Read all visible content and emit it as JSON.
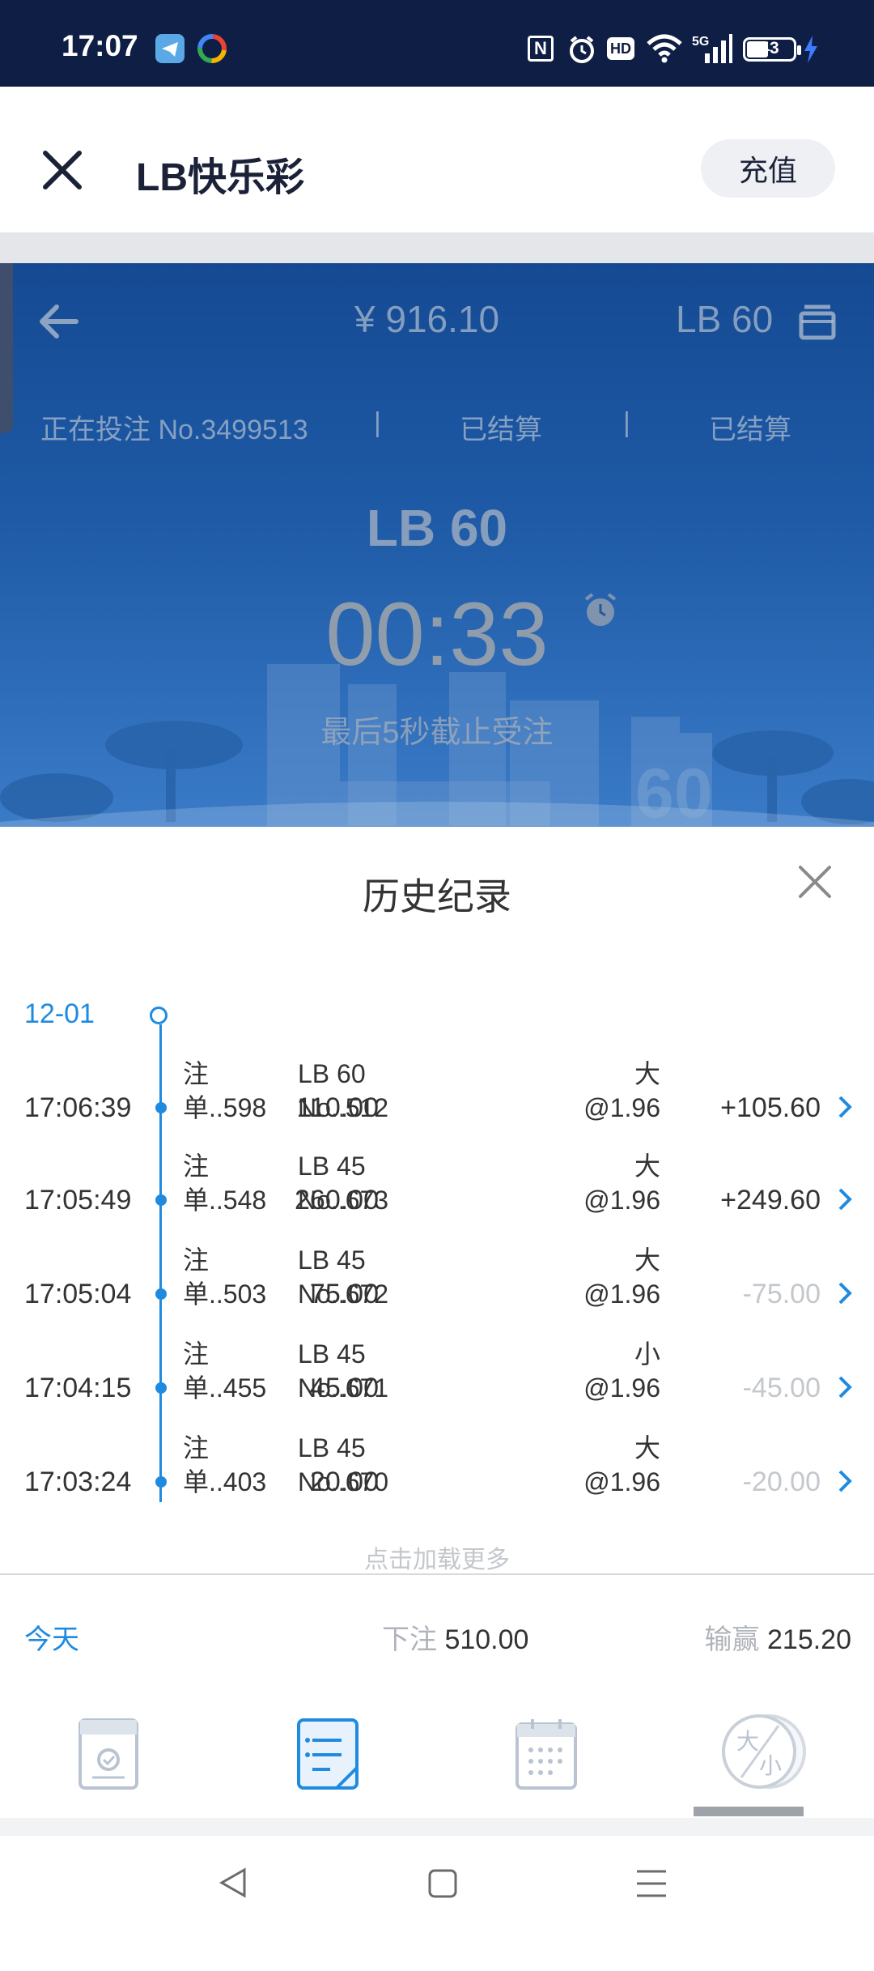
{
  "status": {
    "time": "17:07",
    "battery": "43"
  },
  "header": {
    "title": "LB快乐彩",
    "recharge": "充值"
  },
  "game": {
    "balance": "¥ 916.10",
    "game_name": "LB 60",
    "status_current": "正在投注 No.3499513",
    "status_2": "已结算",
    "status_3": "已结算",
    "big_title": "LB 60",
    "countdown": "00:33",
    "notice": "最后5秒截止受注",
    "watermark": "60"
  },
  "history": {
    "title": "历史纪录",
    "date": "12-01",
    "rows": [
      {
        "time": "17:06:39",
        "order1": "注",
        "order2": "单..598",
        "game1": "LB 60",
        "game2": "No..512",
        "amount": "110.00",
        "pick": "大",
        "odds": "@1.96",
        "result": "+105.60"
      },
      {
        "time": "17:05:49",
        "order1": "注",
        "order2": "单..548",
        "game1": "LB 45",
        "game2": "No..673",
        "amount": "260.00",
        "pick": "大",
        "odds": "@1.96",
        "result": "+249.60"
      },
      {
        "time": "17:05:04",
        "order1": "注",
        "order2": "单..503",
        "game1": "LB 45",
        "game2": "No..672",
        "amount": "75.00",
        "pick": "大",
        "odds": "@1.96",
        "result": "-75.00"
      },
      {
        "time": "17:04:15",
        "order1": "注",
        "order2": "单..455",
        "game1": "LB 45",
        "game2": "No..671",
        "amount": "45.00",
        "pick": "小",
        "odds": "@1.96",
        "result": "-45.00"
      },
      {
        "time": "17:03:24",
        "order1": "注",
        "order2": "单..403",
        "game1": "LB 45",
        "game2": "No..670",
        "amount": "20.00",
        "pick": "大",
        "odds": "@1.96",
        "result": "-20.00"
      }
    ],
    "load_more": "点击加载更多"
  },
  "summary": {
    "period": "今天",
    "bet_label": "下注",
    "bet_value": "510.00",
    "win_label": "输赢",
    "win_value": "215.20"
  },
  "tabs": {
    "bigsmall_big": "大",
    "bigsmall_small": "小"
  },
  "colors": {
    "accent": "#1f8be0",
    "positive": "#333333",
    "negative": "#c4c7cc",
    "status_bar": "#0f1e45",
    "panel": "#1e5aa6"
  }
}
